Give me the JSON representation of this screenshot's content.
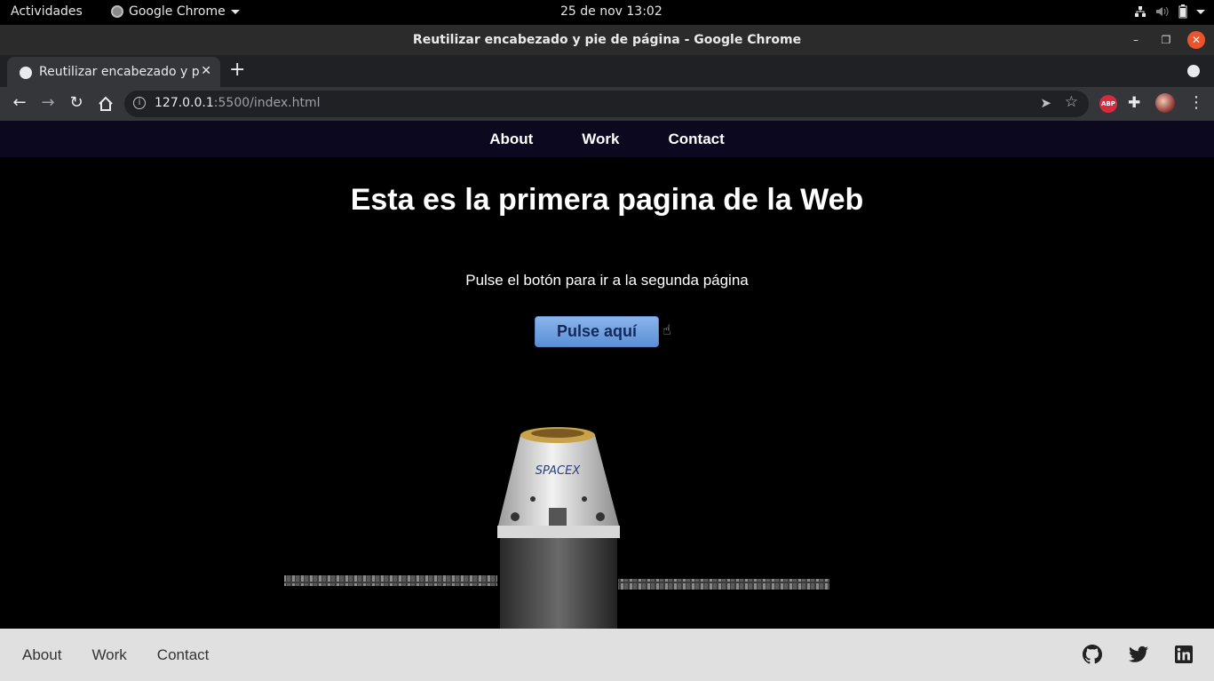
{
  "system_bar": {
    "activities": "Actividades",
    "app_name": "Google Chrome",
    "clock": "25 de nov  13:02"
  },
  "window": {
    "title": "Reutilizar encabezado y pie de página - Google Chrome"
  },
  "tab": {
    "label": "Reutilizar encabezado y pie de página"
  },
  "address_bar": {
    "host": "127.0.0.1",
    "path": ":5500/index.html"
  },
  "extensions": {
    "abp_label": "ABP"
  },
  "site_nav": {
    "items": [
      "About",
      "Work",
      "Contact"
    ]
  },
  "main": {
    "heading": "Esta es la primera pagina de la Web",
    "instruction": "Pulse el botón para ir a la segunda página",
    "button_label": "Pulse aquí",
    "image_logo": "SPACEX"
  },
  "footer": {
    "links": [
      "About",
      "Work",
      "Contact"
    ],
    "social_icons": [
      "github-icon",
      "twitter-icon",
      "linkedin-icon"
    ]
  },
  "colors": {
    "nav_bg": "#0b0820",
    "footer_bg": "#e0e0e0",
    "button_gradient_top": "#8ab4ea",
    "button_gradient_bottom": "#5b8fd6",
    "close_button": "#e9542d"
  }
}
